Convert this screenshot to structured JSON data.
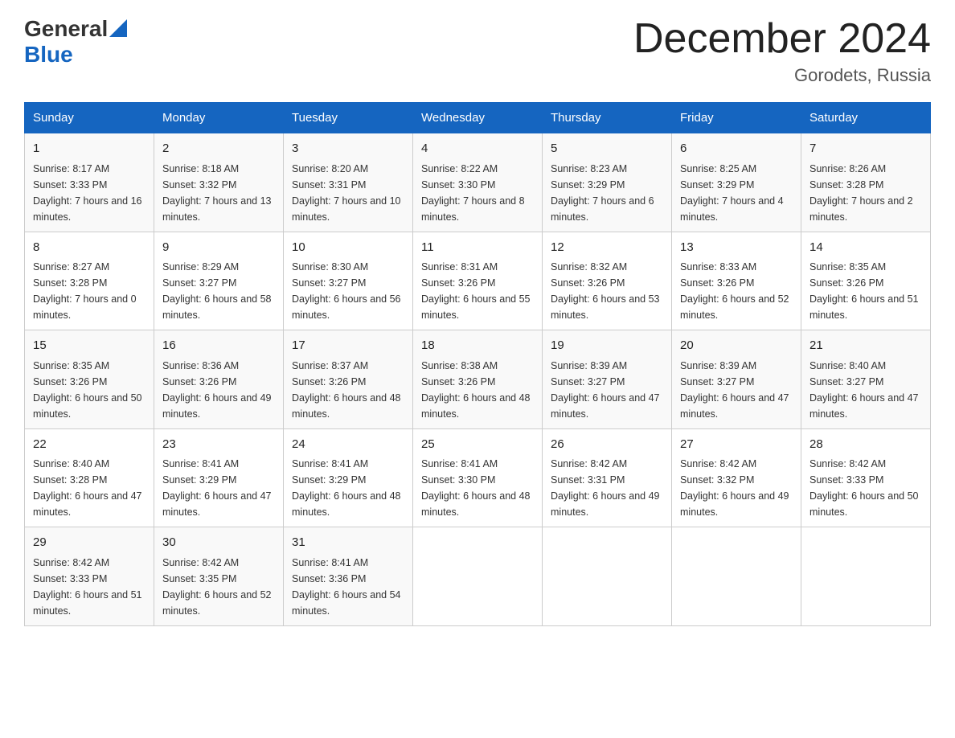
{
  "header": {
    "logo_general": "General",
    "logo_blue": "Blue",
    "month_title": "December 2024",
    "location": "Gorodets, Russia"
  },
  "weekdays": [
    "Sunday",
    "Monday",
    "Tuesday",
    "Wednesday",
    "Thursday",
    "Friday",
    "Saturday"
  ],
  "weeks": [
    [
      {
        "day": "1",
        "sunrise": "8:17 AM",
        "sunset": "3:33 PM",
        "daylight": "7 hours and 16 minutes."
      },
      {
        "day": "2",
        "sunrise": "8:18 AM",
        "sunset": "3:32 PM",
        "daylight": "7 hours and 13 minutes."
      },
      {
        "day": "3",
        "sunrise": "8:20 AM",
        "sunset": "3:31 PM",
        "daylight": "7 hours and 10 minutes."
      },
      {
        "day": "4",
        "sunrise": "8:22 AM",
        "sunset": "3:30 PM",
        "daylight": "7 hours and 8 minutes."
      },
      {
        "day": "5",
        "sunrise": "8:23 AM",
        "sunset": "3:29 PM",
        "daylight": "7 hours and 6 minutes."
      },
      {
        "day": "6",
        "sunrise": "8:25 AM",
        "sunset": "3:29 PM",
        "daylight": "7 hours and 4 minutes."
      },
      {
        "day": "7",
        "sunrise": "8:26 AM",
        "sunset": "3:28 PM",
        "daylight": "7 hours and 2 minutes."
      }
    ],
    [
      {
        "day": "8",
        "sunrise": "8:27 AM",
        "sunset": "3:28 PM",
        "daylight": "7 hours and 0 minutes."
      },
      {
        "day": "9",
        "sunrise": "8:29 AM",
        "sunset": "3:27 PM",
        "daylight": "6 hours and 58 minutes."
      },
      {
        "day": "10",
        "sunrise": "8:30 AM",
        "sunset": "3:27 PM",
        "daylight": "6 hours and 56 minutes."
      },
      {
        "day": "11",
        "sunrise": "8:31 AM",
        "sunset": "3:26 PM",
        "daylight": "6 hours and 55 minutes."
      },
      {
        "day": "12",
        "sunrise": "8:32 AM",
        "sunset": "3:26 PM",
        "daylight": "6 hours and 53 minutes."
      },
      {
        "day": "13",
        "sunrise": "8:33 AM",
        "sunset": "3:26 PM",
        "daylight": "6 hours and 52 minutes."
      },
      {
        "day": "14",
        "sunrise": "8:35 AM",
        "sunset": "3:26 PM",
        "daylight": "6 hours and 51 minutes."
      }
    ],
    [
      {
        "day": "15",
        "sunrise": "8:35 AM",
        "sunset": "3:26 PM",
        "daylight": "6 hours and 50 minutes."
      },
      {
        "day": "16",
        "sunrise": "8:36 AM",
        "sunset": "3:26 PM",
        "daylight": "6 hours and 49 minutes."
      },
      {
        "day": "17",
        "sunrise": "8:37 AM",
        "sunset": "3:26 PM",
        "daylight": "6 hours and 48 minutes."
      },
      {
        "day": "18",
        "sunrise": "8:38 AM",
        "sunset": "3:26 PM",
        "daylight": "6 hours and 48 minutes."
      },
      {
        "day": "19",
        "sunrise": "8:39 AM",
        "sunset": "3:27 PM",
        "daylight": "6 hours and 47 minutes."
      },
      {
        "day": "20",
        "sunrise": "8:39 AM",
        "sunset": "3:27 PM",
        "daylight": "6 hours and 47 minutes."
      },
      {
        "day": "21",
        "sunrise": "8:40 AM",
        "sunset": "3:27 PM",
        "daylight": "6 hours and 47 minutes."
      }
    ],
    [
      {
        "day": "22",
        "sunrise": "8:40 AM",
        "sunset": "3:28 PM",
        "daylight": "6 hours and 47 minutes."
      },
      {
        "day": "23",
        "sunrise": "8:41 AM",
        "sunset": "3:29 PM",
        "daylight": "6 hours and 47 minutes."
      },
      {
        "day": "24",
        "sunrise": "8:41 AM",
        "sunset": "3:29 PM",
        "daylight": "6 hours and 48 minutes."
      },
      {
        "day": "25",
        "sunrise": "8:41 AM",
        "sunset": "3:30 PM",
        "daylight": "6 hours and 48 minutes."
      },
      {
        "day": "26",
        "sunrise": "8:42 AM",
        "sunset": "3:31 PM",
        "daylight": "6 hours and 49 minutes."
      },
      {
        "day": "27",
        "sunrise": "8:42 AM",
        "sunset": "3:32 PM",
        "daylight": "6 hours and 49 minutes."
      },
      {
        "day": "28",
        "sunrise": "8:42 AM",
        "sunset": "3:33 PM",
        "daylight": "6 hours and 50 minutes."
      }
    ],
    [
      {
        "day": "29",
        "sunrise": "8:42 AM",
        "sunset": "3:33 PM",
        "daylight": "6 hours and 51 minutes."
      },
      {
        "day": "30",
        "sunrise": "8:42 AM",
        "sunset": "3:35 PM",
        "daylight": "6 hours and 52 minutes."
      },
      {
        "day": "31",
        "sunrise": "8:41 AM",
        "sunset": "3:36 PM",
        "daylight": "6 hours and 54 minutes."
      },
      null,
      null,
      null,
      null
    ]
  ]
}
